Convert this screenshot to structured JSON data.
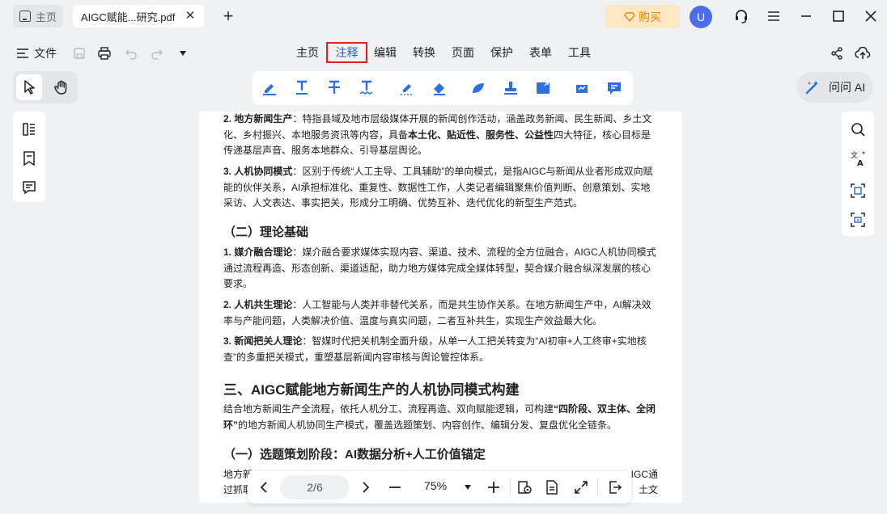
{
  "titlebar": {
    "home_tab": "主页",
    "doc_tab": "AIGC赋能...研究.pdf",
    "close_glyph": "✕",
    "add_glyph": "+",
    "buy": "购买",
    "avatar_initial": "U"
  },
  "menubar": {
    "file": "文件",
    "items": [
      "主页",
      "注释",
      "编辑",
      "转换",
      "页面",
      "保护",
      "表单",
      "工具"
    ],
    "active": "注释"
  },
  "ask_ai": "问问 AI",
  "document": {
    "p1_lead": "2. 地方新闻生产",
    "p1_a": "：特指县域及地市层级媒体开展的新闻创作活动，涵盖政务新闻、民生新闻、乡土文化、乡村振兴、本地服务资讯等内容，具备",
    "p1_b": "本土化、贴近性、服务性、公益性",
    "p1_c": "四大特征，核心目标是传递基层声音、服务本地群众、引导基层舆论。",
    "p2_lead": "3. 人机协同模式",
    "p2_text": "：区别于传统“人工主导、工具辅助”的单向模式，是指AIGC与新闻从业者形成双向赋能的伙伴关系，AI承担标准化、重复性、数据性工作，人类记者编辑聚焦价值判断、创意策划、实地采访、人文表达、事实把关，形成分工明确、优势互补、迭代优化的新型生产范式。",
    "h2": "（二）理论基础",
    "p3_lead": "1. 媒介融合理论",
    "p3_text": "：媒介融合要求媒体实现内容、渠道、技术、流程的全方位融合，AIGC人机协同模式通过流程再造、形态创新、渠道适配，助力地方媒体完成全媒体转型，契合媒介融合纵深发展的核心要求。",
    "p4_lead": "2. 人机共生理论",
    "p4_text": "：人工智能与人类并非替代关系，而是共生协作关系。在地方新闻生产中，AI解决效率与产能问题，人类解决价值、温度与真实问题，二者互补共生，实现生产效益最大化。",
    "p5_lead": "3. 新闻把关人理论",
    "p5_text": "：智媒时代把关机制全面升级，从单一人工把关转变为“AI初审+人工终审+实地核查”的多重把关模式，重塑基层新闻内容审核与舆论管控体系。",
    "h3": "三、AIGC赋能地方新闻生产的人机协同模式构建",
    "p6_a": "结合地方新闻生产全流程，依托人机分工、流程再造、双向赋能逻辑，可构建",
    "p6_b": "“四阶段、双主体、全闭环”",
    "p6_c": "的地方新闻人机协同生产模式，覆盖选题策划、内容创作、编辑分发、复盘优化全链条。",
    "h4": "（一）选题策划阶段：AI数据分析+人工价值锚定",
    "p7_left": "地方新",
    "p7_right": "IGC通",
    "p8_left": "过抓取",
    "p8_right": "土文"
  },
  "bottom_nav": {
    "page_indicator": "2/6",
    "zoom": "75%"
  },
  "colors": {
    "accent": "#2a5fe0",
    "active_border": "#e02020",
    "buy_bg": "#fde7c4",
    "buy_text": "#e58a00",
    "avatar_bg": "#4b6ee8",
    "annot_blue": "#2f6fe4"
  },
  "icons": [
    "home-icon",
    "hamburger-icon",
    "save-icon",
    "print-icon",
    "undo-icon",
    "redo-icon",
    "caret-down-icon",
    "share-icon",
    "cloud-upload-icon",
    "pointer-icon",
    "hand-icon",
    "highlight-icon",
    "underline-icon",
    "strikethrough-icon",
    "squiggly-icon",
    "area-highlight-icon",
    "eraser-icon",
    "shape-icon",
    "stamp-icon",
    "text-box-icon",
    "signature-icon",
    "comment-icon",
    "ai-icon",
    "thumbnails-icon",
    "bookmark-icon",
    "comments-panel-icon",
    "search-icon",
    "translate-icon",
    "ocr-icon",
    "screen-capture-icon",
    "prev-page-icon",
    "next-page-icon",
    "zoom-out-icon",
    "zoom-in-icon",
    "read-mode-icon",
    "document-icon",
    "fit-page-icon",
    "exit-icon",
    "support-icon",
    "menu-icon",
    "minimize-icon",
    "maximize-icon",
    "close-icon"
  ]
}
